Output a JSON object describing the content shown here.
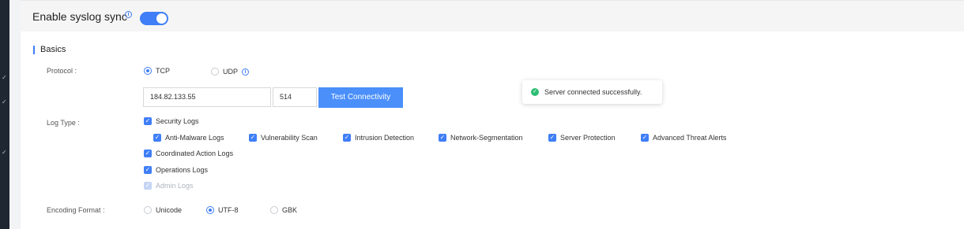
{
  "header": {
    "title": "Enable syslog sync",
    "toggle_on": true
  },
  "section": {
    "title": "Basics"
  },
  "protocol": {
    "label": "Protocol :",
    "options": [
      {
        "label": "TCP",
        "selected": true
      },
      {
        "label": "UDP",
        "selected": false
      }
    ]
  },
  "server": {
    "address": "184.82.133.55",
    "port": "514",
    "test_button": "Test Connectivity"
  },
  "toast": {
    "message": "Server connected successfully."
  },
  "log_type": {
    "label": "Log Type :",
    "security_logs": "Security Logs",
    "sub_items": [
      "Anti-Malware Logs",
      "Vulnerability Scan",
      "Intrusion Detection",
      "Network-Segmentation",
      "Server Protection",
      "Advanced Threat Alerts"
    ],
    "coordinated": "Coordinated Action Logs",
    "operations": "Operations Logs",
    "admin": "Admin Logs"
  },
  "encoding": {
    "label": "Encoding Format :",
    "options": [
      {
        "label": "Unicode",
        "selected": false
      },
      {
        "label": "UTF-8",
        "selected": true
      },
      {
        "label": "GBK",
        "selected": false
      }
    ]
  },
  "colors": {
    "accent": "#3f7ef7",
    "success": "#2fbe75"
  }
}
